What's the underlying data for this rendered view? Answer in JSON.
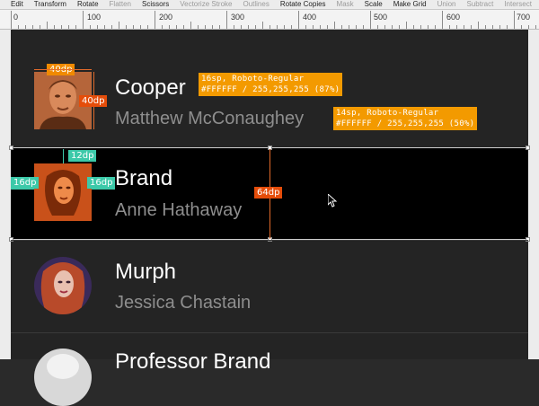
{
  "toolbar": {
    "items": [
      {
        "label": "Edit",
        "enabled": true
      },
      {
        "label": "Transform",
        "enabled": true
      },
      {
        "label": "Rotate",
        "enabled": true
      },
      {
        "label": "Flatten",
        "enabled": false
      },
      {
        "label": "Scissors",
        "enabled": true
      },
      {
        "label": "Vectorize Stroke",
        "enabled": false
      },
      {
        "label": "Outlines",
        "enabled": false
      },
      {
        "label": "Rotate Copies",
        "enabled": true
      },
      {
        "label": "Mask",
        "enabled": false
      },
      {
        "label": "Scale",
        "enabled": true
      },
      {
        "label": "Make Grid",
        "enabled": true
      },
      {
        "label": "Union",
        "enabled": false
      },
      {
        "label": "Subtract",
        "enabled": false
      },
      {
        "label": "Intersect",
        "enabled": false
      }
    ]
  },
  "ruler": {
    "labels": [
      "0",
      "100",
      "200",
      "300",
      "400",
      "500",
      "600",
      "700"
    ]
  },
  "list": {
    "items": [
      {
        "name": "Cooper",
        "actor": "Matthew McConaughey"
      },
      {
        "name": "Brand",
        "actor": "Anne Hathaway"
      },
      {
        "name": "Murph",
        "actor": "Jessica Chastain"
      },
      {
        "name": "Professor Brand",
        "actor": ""
      }
    ]
  },
  "annotations": {
    "avatar_width": "40dp",
    "avatar_height": "40dp",
    "primary_spec_line1": "16sp, Roboto-Regular",
    "primary_spec_line2": "#FFFFFF / 255,255,255 (87%)",
    "secondary_spec_line1": "14sp, Roboto-Regular",
    "secondary_spec_line2": "#FFFFFF / 255,255,255 (50%)",
    "top_padding": "12dp",
    "left_padding": "16dp",
    "avatar_text_gap": "16dp",
    "row_height": "64dp"
  },
  "colors": {
    "toolbar_bg": "#ececec",
    "artboard_bg": "#242424",
    "selected_row_bg": "#000000",
    "spec_orange": "#f39a00",
    "measure_red": "#e54d0a",
    "measure_teal": "#3cc9a9",
    "primary_text": "#ffffff",
    "secondary_text": "#8e8e8e"
  }
}
